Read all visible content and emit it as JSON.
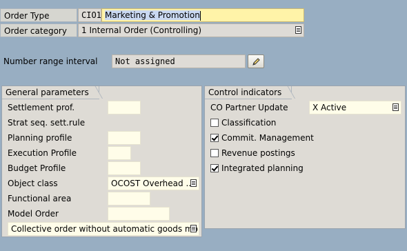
{
  "header": {
    "order_type_label": "Order Type",
    "order_type_code": "CIO1",
    "order_type_name": "Marketing & Promotion",
    "order_category_label": "Order category",
    "order_category_value": "1 Internal Order (Controlling)",
    "number_range_label": "Number range interval",
    "number_range_value": "Not assigned"
  },
  "general": {
    "title": "General parameters",
    "settlement_prof": "Settlement prof.",
    "strat_seq": "Strat seq. sett.rule",
    "planning_profile": "Planning profile",
    "execution_profile": "Execution Profile",
    "budget_profile": "Budget Profile",
    "object_class": "Object class",
    "object_class_value": "OCOST Overhead ...",
    "functional_area": "Functional area",
    "model_order": "Model Order",
    "collective_order_value": "Collective order without automatic goods mo..."
  },
  "control": {
    "title": "Control indicators",
    "co_partner_label": "CO Partner Update",
    "co_partner_value": "X Active",
    "classification": "Classification",
    "classification_checked": false,
    "commit_mgmt": "Commit. Management",
    "commit_mgmt_checked": true,
    "revenue_postings": "Revenue postings",
    "revenue_postings_checked": false,
    "integrated_planning": "Integrated planning",
    "integrated_planning_checked": true
  },
  "icons": {
    "dropdown": "dropdown-list-icon",
    "edit": "pencil-icon"
  }
}
